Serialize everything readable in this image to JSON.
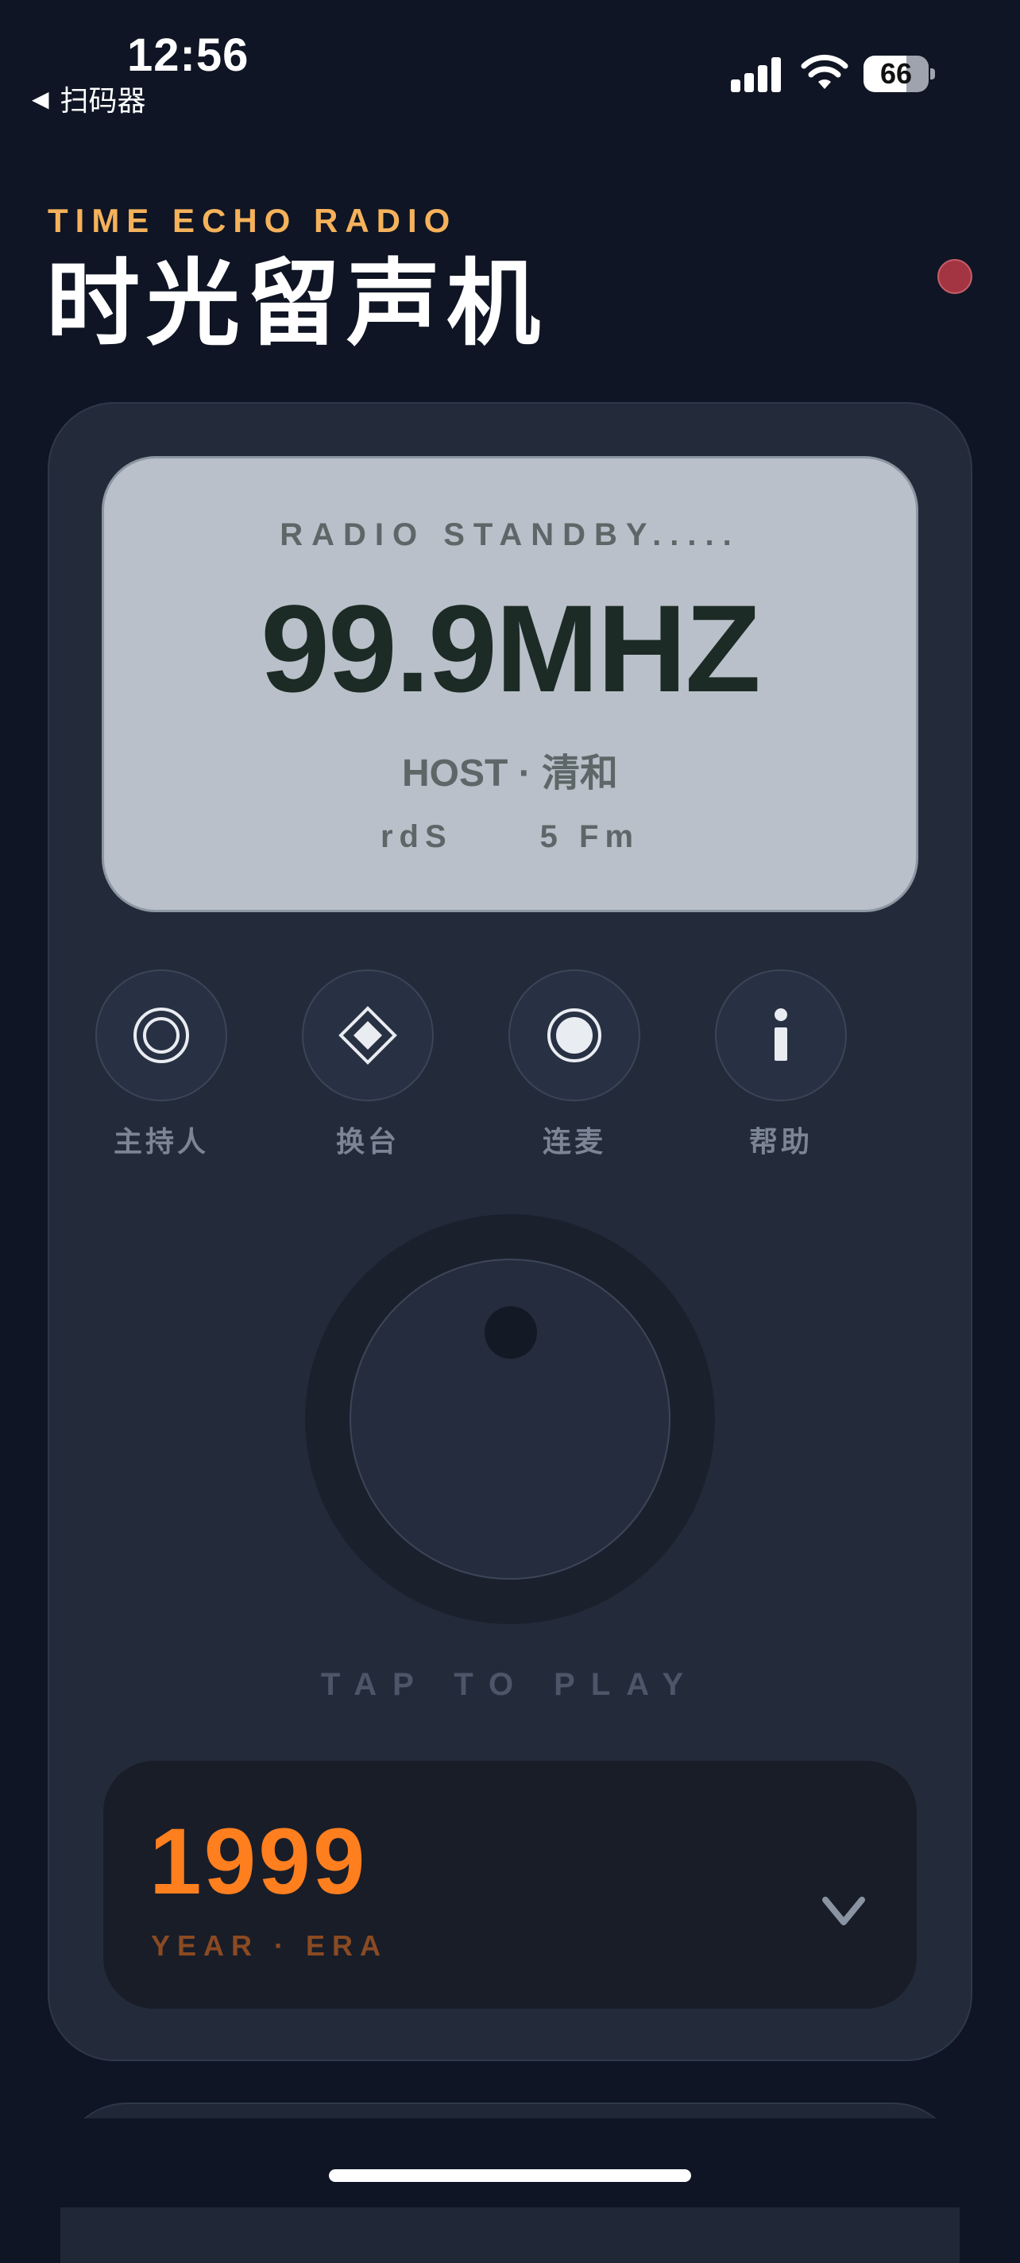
{
  "status_bar": {
    "time": "12:56",
    "back_label": "扫码器",
    "back_icon": "◀",
    "battery_level": 66,
    "battery_text": "66",
    "signal_bars": 4
  },
  "header": {
    "eyebrow": "TIME ECHO RADIO",
    "title": "时光留声机",
    "accent_color": "#f5b25b"
  },
  "display": {
    "status": "RADIO STANDBY.....",
    "frequency": "99.9MHZ",
    "host": "HOST · 清和",
    "meta_left": "rdS",
    "meta_right": "5 Fm"
  },
  "controls": [
    {
      "label": "主持人",
      "icon": "host-ring-icon"
    },
    {
      "label": "换台",
      "icon": "diamond-icon"
    },
    {
      "label": "连麦",
      "icon": "record-icon"
    },
    {
      "label": "帮助",
      "icon": "info-icon"
    }
  ],
  "knob": {
    "hint": "TAP TO PLAY"
  },
  "year_selector": {
    "value": "1999",
    "label": "YEAR · ERA",
    "value_color": "#ff7f1f"
  }
}
